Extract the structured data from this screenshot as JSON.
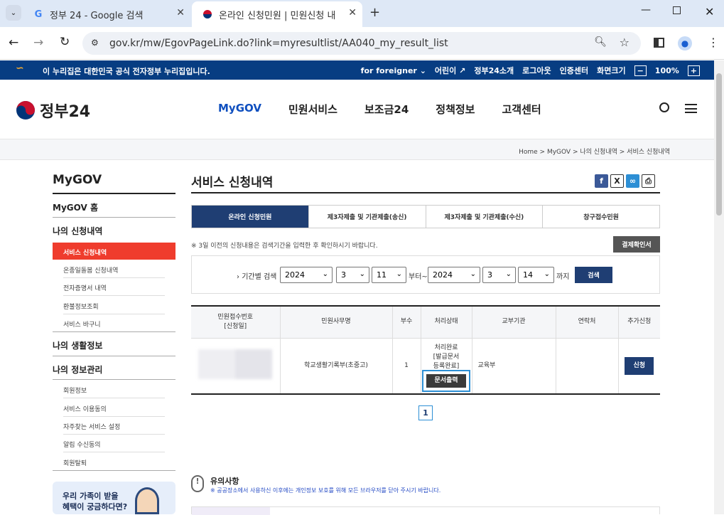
{
  "browser": {
    "tabs": [
      {
        "title": "정부 24 - Google 검색",
        "active": false
      },
      {
        "title": "온라인 신청민원 | 민원신청 내",
        "active": true
      }
    ],
    "url": "gov.kr/mw/EgovPageLink.do?link=myresultlist/AA040_my_result_list"
  },
  "govbar": {
    "notice": "이 누리집은 대한민국 공식 전자정부 누리집입니다.",
    "links": [
      "for foreigner",
      "어린이",
      "정부24소개",
      "로그아웃",
      "인증센터",
      "화면크기"
    ],
    "zoom": "100%"
  },
  "header": {
    "logo": "정부24",
    "nav": [
      "MyGOV",
      "민원서비스",
      "보조금24",
      "정책정보",
      "고객센터"
    ]
  },
  "breadcrumb": [
    "Home",
    "MyGOV",
    "나의 신청내역",
    "서비스 신청내역"
  ],
  "sidebar": {
    "title": "MyGOV",
    "home": "MyGOV 홈",
    "group1": "나의 신청내역",
    "group1_items": [
      "서비스 신청내역",
      "온종일돌봄 신청내역",
      "전자증명서 내역",
      "환불정보조회",
      "서비스 바구니"
    ],
    "group2": "나의 생활정보",
    "group3": "나의 정보관리",
    "group3_items": [
      "회원정보",
      "서비스 이용동의",
      "자주찾는 서비스 설정",
      "알림 수신동의",
      "회원탈퇴"
    ],
    "promo_line1": "우리 가족이 받을",
    "promo_line2": "혜택이 궁금하다면?"
  },
  "main": {
    "title": "서비스 신청내역",
    "tabs": [
      "온라인 신청민원",
      "제3자제출 및 기관제출(송신)",
      "제3자제출 및 기관제출(수신)",
      "창구접수민원"
    ],
    "note": "※ 3일 이전의 신청내용은 검색기간을 입력한 후 확인하시기 바랍니다.",
    "confirm_button": "결제확인서",
    "search": {
      "label": "기간별 검색",
      "from_year": "2024",
      "from_month": "3",
      "from_day": "11",
      "from_suffix": "부터~",
      "to_year": "2024",
      "to_month": "3",
      "to_day": "14",
      "to_suffix": "까지",
      "button": "검색"
    },
    "table": {
      "headers": [
        "민원접수번호\n[신청일]",
        "민원사무명",
        "부수",
        "처리상태",
        "교부기관",
        "연락처",
        "추가신청"
      ],
      "row": {
        "name": "학교생활기록부(초중고)",
        "copies": "1",
        "status1": "처리완료",
        "status2": "[발급문서",
        "status3": "등록완료]",
        "print_button": "문서출력",
        "agency": "교육부",
        "contact": "",
        "apply_button": "신청"
      }
    },
    "page": "1",
    "notice_title": "유의사항",
    "notice_text": "※ 공공장소에서 사용하신 이후에는 개인정보 보호를 위해 모든 브라우저를 닫아 주시기 바랍니다."
  }
}
